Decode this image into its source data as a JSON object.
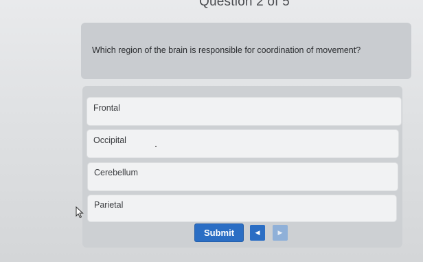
{
  "header": {
    "question_counter": "Question 2 of 5"
  },
  "question": {
    "text": "Which region of the brain is responsible for coordination of movement?"
  },
  "options": [
    {
      "label": "Frontal"
    },
    {
      "label": "Occipital"
    },
    {
      "label": "Cerebellum"
    },
    {
      "label": "Parietal"
    }
  ],
  "controls": {
    "submit_label": "Submit",
    "prev_icon": "◀",
    "next_icon": "▶"
  },
  "colors": {
    "accent": "#2b6ec4",
    "accent_disabled": "#8fb0d8",
    "card": "#c9ccd0",
    "option_bg": "#f1f2f3"
  },
  "icons": [
    "previous-arrow-icon",
    "next-arrow-icon",
    "mouse-pointer-icon"
  ]
}
